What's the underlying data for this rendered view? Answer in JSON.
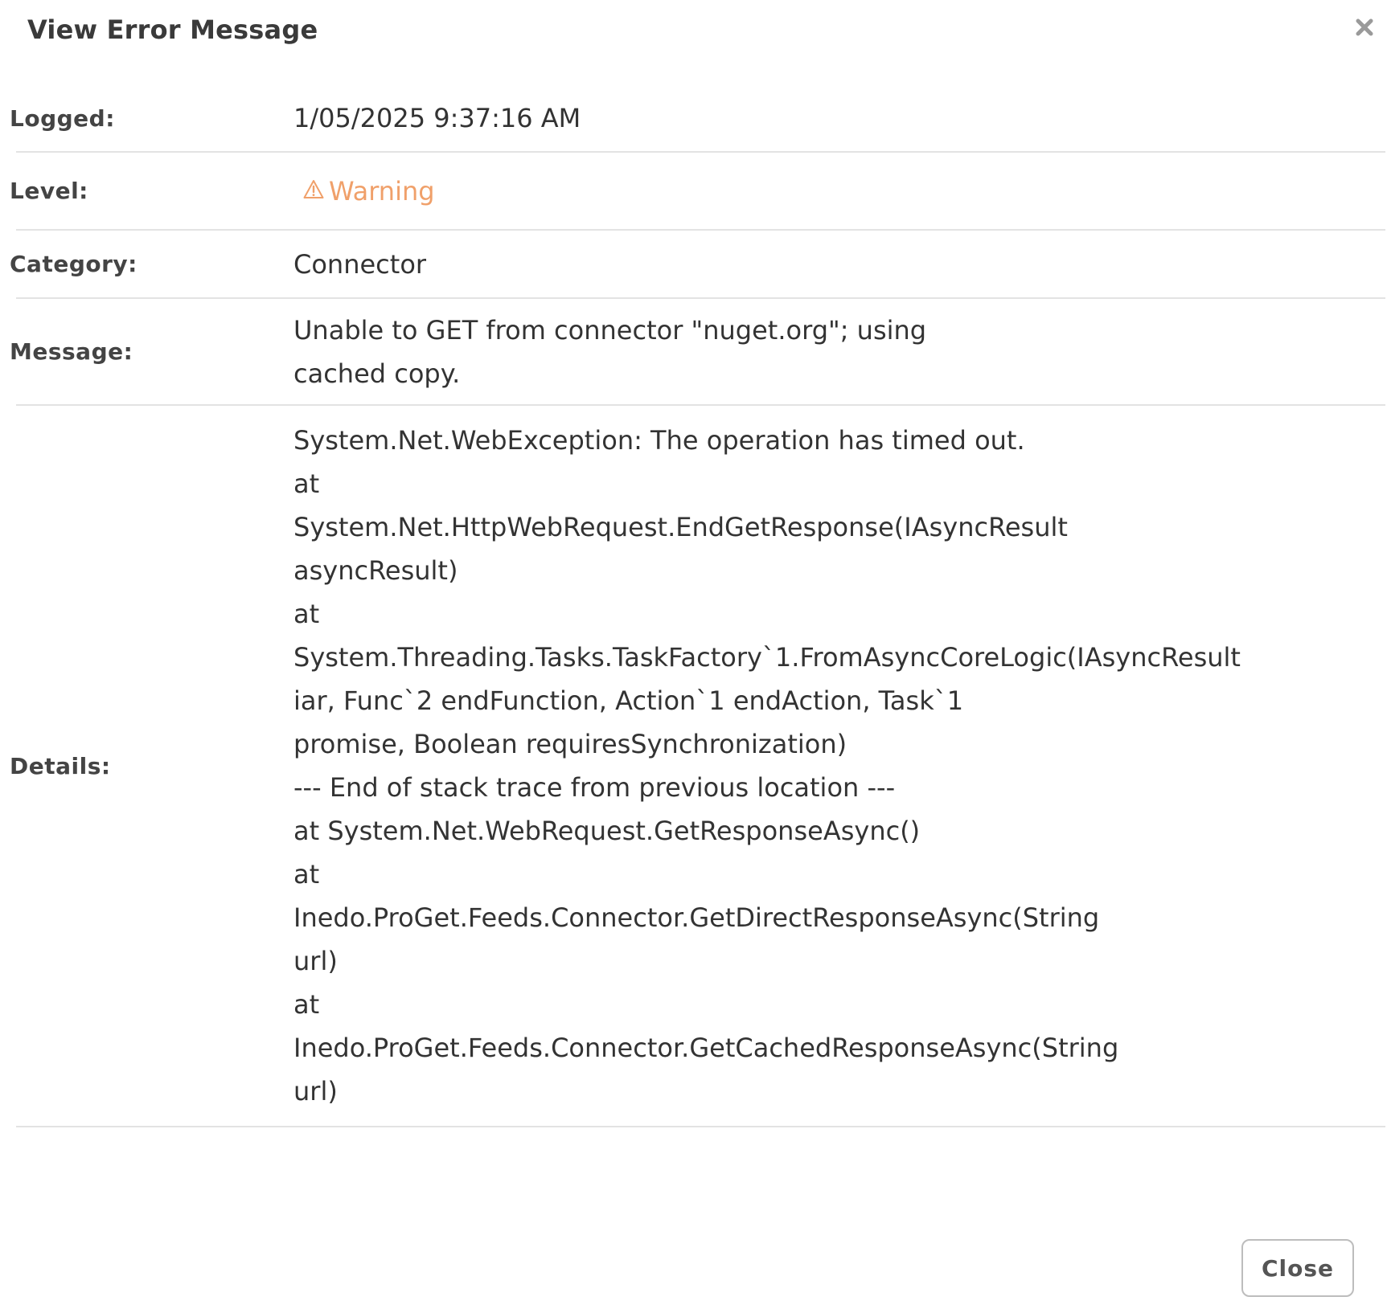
{
  "dialog": {
    "title": "View Error Message",
    "close_icon": "close-icon"
  },
  "fields": {
    "logged": {
      "label": "Logged:",
      "value": "1/05/2025 9:37:16 AM"
    },
    "level": {
      "label": "Level:",
      "value": "Warning",
      "icon": "warning-triangle-icon",
      "color": "#f0a06a"
    },
    "category": {
      "label": "Category:",
      "value": "Connector"
    },
    "message": {
      "label": "Message:",
      "value": "Unable to GET from connector \"nuget.org\"; using cached copy."
    },
    "details": {
      "label": "Details:",
      "lines": [
        "System.Net.WebException: The operation has timed out.",
        "at",
        "System.Net.HttpWebRequest.EndGetResponse(IAsyncResult",
        "asyncResult)",
        "at",
        "System.Threading.Tasks.TaskFactory`1.FromAsyncCoreLogic(IAsyncResult",
        "iar, Func`2 endFunction, Action`1 endAction, Task`1",
        "promise, Boolean requiresSynchronization)",
        "--- End of stack trace from previous location ---",
        "at System.Net.WebRequest.GetResponseAsync()",
        "at",
        "Inedo.ProGet.Feeds.Connector.GetDirectResponseAsync(String",
        "url)",
        "at",
        "Inedo.ProGet.Feeds.Connector.GetCachedResponseAsync(String",
        "url)"
      ]
    }
  },
  "footer": {
    "close_label": "Close"
  }
}
